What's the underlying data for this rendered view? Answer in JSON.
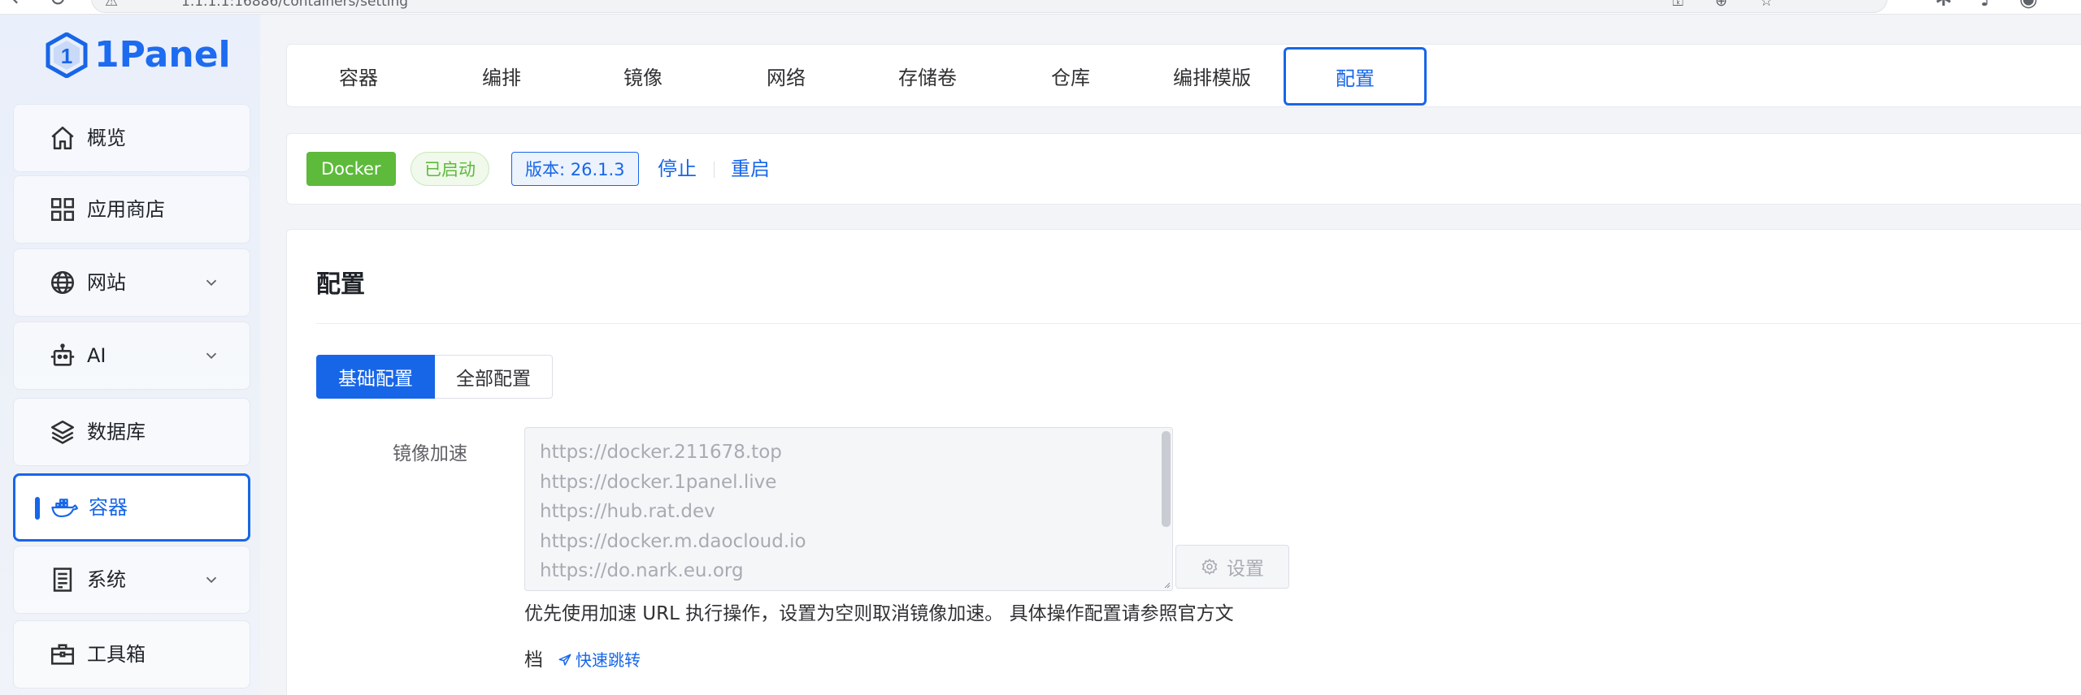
{
  "browser": {
    "url": "1.1.1.1:16886/containers/setting"
  },
  "brand": {
    "name": "1Panel",
    "color": "#1766e8"
  },
  "sidebar": {
    "items": [
      {
        "label": "概览",
        "icon": "home-icon"
      },
      {
        "label": "应用商店",
        "icon": "grid-icon"
      },
      {
        "label": "网站",
        "icon": "globe-icon",
        "expandable": true
      },
      {
        "label": "AI",
        "icon": "robot-icon",
        "expandable": true
      },
      {
        "label": "数据库",
        "icon": "layers-icon"
      },
      {
        "label": "容器",
        "icon": "docker-icon",
        "active": true
      },
      {
        "label": "系统",
        "icon": "server-icon",
        "expandable": true
      },
      {
        "label": "工具箱",
        "icon": "toolbox-icon"
      }
    ]
  },
  "tabs": [
    {
      "label": "容器"
    },
    {
      "label": "编排"
    },
    {
      "label": "镜像"
    },
    {
      "label": "网络"
    },
    {
      "label": "存储卷"
    },
    {
      "label": "仓库"
    },
    {
      "label": "编排模版"
    },
    {
      "label": "配置",
      "active": true
    }
  ],
  "status": {
    "service": "Docker",
    "state": "已启动",
    "version": "版本: 26.1.3",
    "stop": "停止",
    "restart": "重启"
  },
  "config": {
    "title": "配置",
    "segments": [
      {
        "label": "基础配置",
        "active": true
      },
      {
        "label": "全部配置"
      }
    ],
    "mirror_label": "镜像加速",
    "mirrors": [
      "https://docker.211678.top",
      "https://docker.1panel.live",
      "https://hub.rat.dev",
      "https://docker.m.daocloud.io",
      "https://do.nark.eu.org"
    ],
    "settings_button": "设置",
    "help_text": "优先使用加速 URL 执行操作，设置为空则取消镜像加速。 具体操作配置请参照官方文",
    "help_text_tail": "档",
    "quick_link": "快速跳转"
  },
  "colors": {
    "accent": "#1766e8",
    "success": "#5dba3b",
    "sidebar_bg": "#e9effb"
  }
}
